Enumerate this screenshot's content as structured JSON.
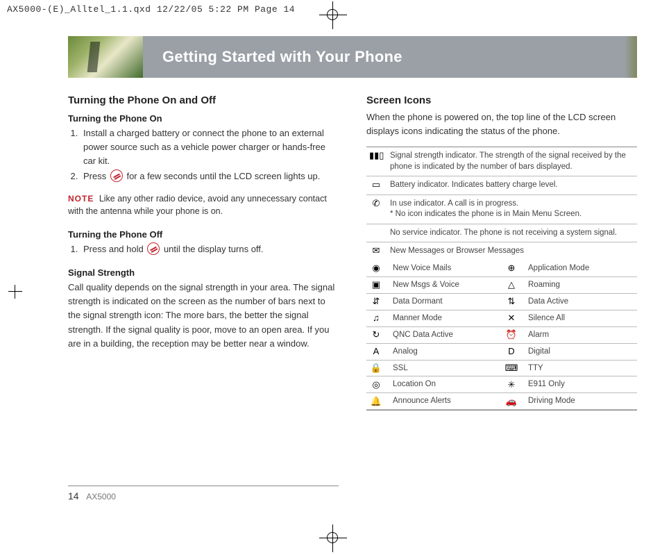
{
  "print_header": "AX5000-(E)_Alltel_1.1.qxd  12/22/05  5:22 PM  Page 14",
  "page_title": "Getting Started with Your Phone",
  "footer": {
    "page_number": "14",
    "model": "AX5000"
  },
  "left": {
    "h_onoff": "Turning the Phone On and Off",
    "h_on": "Turning the Phone On",
    "on_steps": [
      "Install a charged battery or connect the phone to an external power source such as a vehicle power charger or hands-free car kit.",
      "Press       for a few seconds until the LCD screen lights up."
    ],
    "note_label": "NOTE",
    "note_text": "Like any other radio device, avoid any unnecessary contact with the antenna while your phone is on.",
    "h_off": "Turning the Phone Off",
    "off_step": "Press and hold       until the display turns off.",
    "h_signal": "Signal Strength",
    "signal_body": "Call quality depends on the signal strength in your area. The signal strength is indicated on the screen as the number of bars next to the signal strength icon: The more bars, the better the signal strength. If the signal quality is poor, move to an open area. If you are in a building, the reception may be better near a window."
  },
  "right": {
    "h_icons": "Screen Icons",
    "intro": "When the phone is powered on, the top line of the LCD screen displays icons indicating the status of the phone.",
    "full_rows": [
      {
        "icon": "signal-icon",
        "glyph": "▮▮▯",
        "text": "Signal strength indicator. The strength of the signal received by the phone is indicated by the number of bars displayed."
      },
      {
        "icon": "battery-icon",
        "glyph": "▭",
        "text": "Battery indicator. Indicates battery charge level."
      },
      {
        "icon": "inuse-icon",
        "glyph": "✆",
        "text": "In use indicator. A call is in progress.\n* No icon indicates the phone is in Main Menu Screen."
      },
      {
        "icon": "noservice-icon",
        "glyph": " ",
        "text": "No service indicator. The phone is not receiving a system signal."
      },
      {
        "icon": "message-icon",
        "glyph": "✉",
        "text": "New Messages or Browser Messages"
      }
    ],
    "grid_rows": [
      {
        "l_icon": "voicemail-icon",
        "l_glyph": "◉",
        "l": "New Voice Mails",
        "r_icon": "appmode-icon",
        "r_glyph": "⊕",
        "r": "Application Mode"
      },
      {
        "l_icon": "msgsvoice-icon",
        "l_glyph": "▣",
        "l": "New Msgs & Voice",
        "r_icon": "roaming-icon",
        "r_glyph": "△",
        "r": "Roaming"
      },
      {
        "l_icon": "datadormant-icon",
        "l_glyph": "⇵",
        "l": "Data Dormant",
        "r_icon": "dataactive-icon",
        "r_glyph": "⇅",
        "r": "Data Active"
      },
      {
        "l_icon": "manner-icon",
        "l_glyph": "♫",
        "l": "Manner Mode",
        "r_icon": "silence-icon",
        "r_glyph": "✕",
        "r": "Silence All"
      },
      {
        "l_icon": "qnc-icon",
        "l_glyph": "↻",
        "l": "QNC Data Active",
        "r_icon": "alarm-icon",
        "r_glyph": "⏰",
        "r": "Alarm"
      },
      {
        "l_icon": "analog-icon",
        "l_glyph": "A",
        "l": "Analog",
        "r_icon": "digital-icon",
        "r_glyph": "D",
        "r": "Digital"
      },
      {
        "l_icon": "ssl-icon",
        "l_glyph": "🔒",
        "l": "SSL",
        "r_icon": "tty-icon",
        "r_glyph": "⌨",
        "r": "TTY"
      },
      {
        "l_icon": "location-icon",
        "l_glyph": "◎",
        "l": "Location On",
        "r_icon": "e911-icon",
        "r_glyph": "✳",
        "r": "E911 Only"
      },
      {
        "l_icon": "announce-icon",
        "l_glyph": "🔔",
        "l": "Announce Alerts",
        "r_icon": "driving-icon",
        "r_glyph": "🚗",
        "r": "Driving Mode"
      }
    ]
  }
}
